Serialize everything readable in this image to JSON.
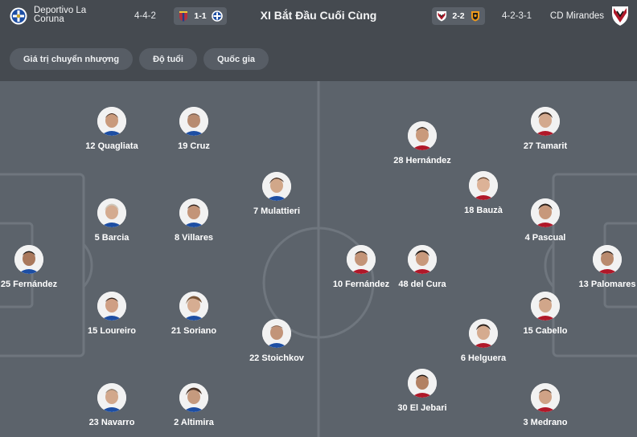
{
  "header": {
    "home_team": "Deportivo La Coruna",
    "home_formation": "4-4-2",
    "home_result": {
      "score": "1-1"
    },
    "title": "XI Bắt Đầu Cuối Cùng",
    "away_result": {
      "score": "2-2"
    },
    "away_formation": "4-2-3-1",
    "away_team": "CD Mirandes",
    "colors": {
      "home_blue": "#1d4ea3",
      "away_red": "#b01829",
      "levante_red": "#b6303d",
      "valencia_orange": "#f09a1a"
    }
  },
  "tabs": [
    {
      "label": "Giá trị chuyển nhượng"
    },
    {
      "label": "Độ tuổi"
    },
    {
      "label": "Quốc gia"
    }
  ],
  "home_players": [
    {
      "label": "12 Quagliata"
    },
    {
      "label": "19 Cruz"
    },
    {
      "label": "7 Mulattieri"
    },
    {
      "label": "5 Barcia"
    },
    {
      "label": "8 Villares"
    },
    {
      "label": "25 Fernández"
    },
    {
      "label": "15 Loureiro"
    },
    {
      "label": "21 Soriano"
    },
    {
      "label": "22 Stoichkov"
    },
    {
      "label": "23 Navarro"
    },
    {
      "label": "2 Altimira"
    }
  ],
  "away_players": [
    {
      "label": "28 Hernández"
    },
    {
      "label": "27 Tamarit"
    },
    {
      "label": "18 Bauzà"
    },
    {
      "label": "4 Pascual"
    },
    {
      "label": "10 Fernández"
    },
    {
      "label": "48 del Cura"
    },
    {
      "label": "13 Palomares"
    },
    {
      "label": "15 Cabello"
    },
    {
      "label": "6 Helguera"
    },
    {
      "label": "30 El Jebari"
    },
    {
      "label": "3 Medrano"
    }
  ]
}
